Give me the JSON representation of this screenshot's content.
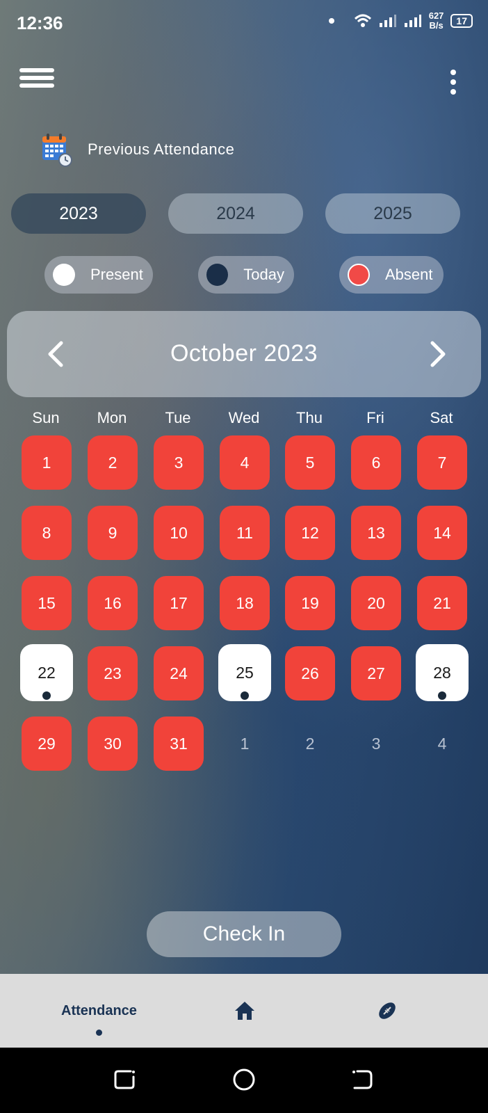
{
  "status": {
    "time": "12:36",
    "net_speed_value": "627",
    "net_speed_unit": "B/s",
    "battery": "17"
  },
  "header": {
    "section_title": "Previous Attendance"
  },
  "years": [
    {
      "label": "2023",
      "active": true
    },
    {
      "label": "2024",
      "active": false
    },
    {
      "label": "2025",
      "active": false
    }
  ],
  "legend": [
    {
      "label": "Present",
      "color": "#ffffff"
    },
    {
      "label": "Today",
      "color": "#1a2e48"
    },
    {
      "label": "Absent",
      "color": "#f14a47"
    }
  ],
  "calendar": {
    "month_title": "October 2023",
    "weekdays": [
      "Sun",
      "Mon",
      "Tue",
      "Wed",
      "Thu",
      "Fri",
      "Sat"
    ],
    "weeks": [
      [
        {
          "d": "1",
          "s": "absent"
        },
        {
          "d": "2",
          "s": "absent"
        },
        {
          "d": "3",
          "s": "absent"
        },
        {
          "d": "4",
          "s": "absent"
        },
        {
          "d": "5",
          "s": "absent"
        },
        {
          "d": "6",
          "s": "absent"
        },
        {
          "d": "7",
          "s": "absent"
        }
      ],
      [
        {
          "d": "8",
          "s": "absent"
        },
        {
          "d": "9",
          "s": "absent"
        },
        {
          "d": "10",
          "s": "absent"
        },
        {
          "d": "11",
          "s": "absent"
        },
        {
          "d": "12",
          "s": "absent"
        },
        {
          "d": "13",
          "s": "absent"
        },
        {
          "d": "14",
          "s": "absent"
        }
      ],
      [
        {
          "d": "15",
          "s": "absent"
        },
        {
          "d": "16",
          "s": "absent"
        },
        {
          "d": "17",
          "s": "absent"
        },
        {
          "d": "18",
          "s": "absent"
        },
        {
          "d": "19",
          "s": "absent"
        },
        {
          "d": "20",
          "s": "absent"
        },
        {
          "d": "21",
          "s": "absent"
        }
      ],
      [
        {
          "d": "22",
          "s": "present"
        },
        {
          "d": "23",
          "s": "absent"
        },
        {
          "d": "24",
          "s": "absent"
        },
        {
          "d": "25",
          "s": "present"
        },
        {
          "d": "26",
          "s": "absent"
        },
        {
          "d": "27",
          "s": "absent"
        },
        {
          "d": "28",
          "s": "present"
        }
      ],
      [
        {
          "d": "29",
          "s": "absent"
        },
        {
          "d": "30",
          "s": "absent"
        },
        {
          "d": "31",
          "s": "absent"
        },
        {
          "d": "1",
          "s": "other"
        },
        {
          "d": "2",
          "s": "other"
        },
        {
          "d": "3",
          "s": "other"
        },
        {
          "d": "4",
          "s": "other"
        }
      ]
    ]
  },
  "actions": {
    "check_in": "Check In"
  },
  "bottom_nav": {
    "items": [
      {
        "label": "Attendance",
        "icon": "calendar-icon",
        "active": true
      },
      {
        "label": "",
        "icon": "home-icon",
        "active": false
      },
      {
        "label": "",
        "icon": "football-icon",
        "active": false
      }
    ]
  },
  "colors": {
    "absent": "#f1433a",
    "present": "#ffffff",
    "nav_accent": "#1a3354"
  }
}
